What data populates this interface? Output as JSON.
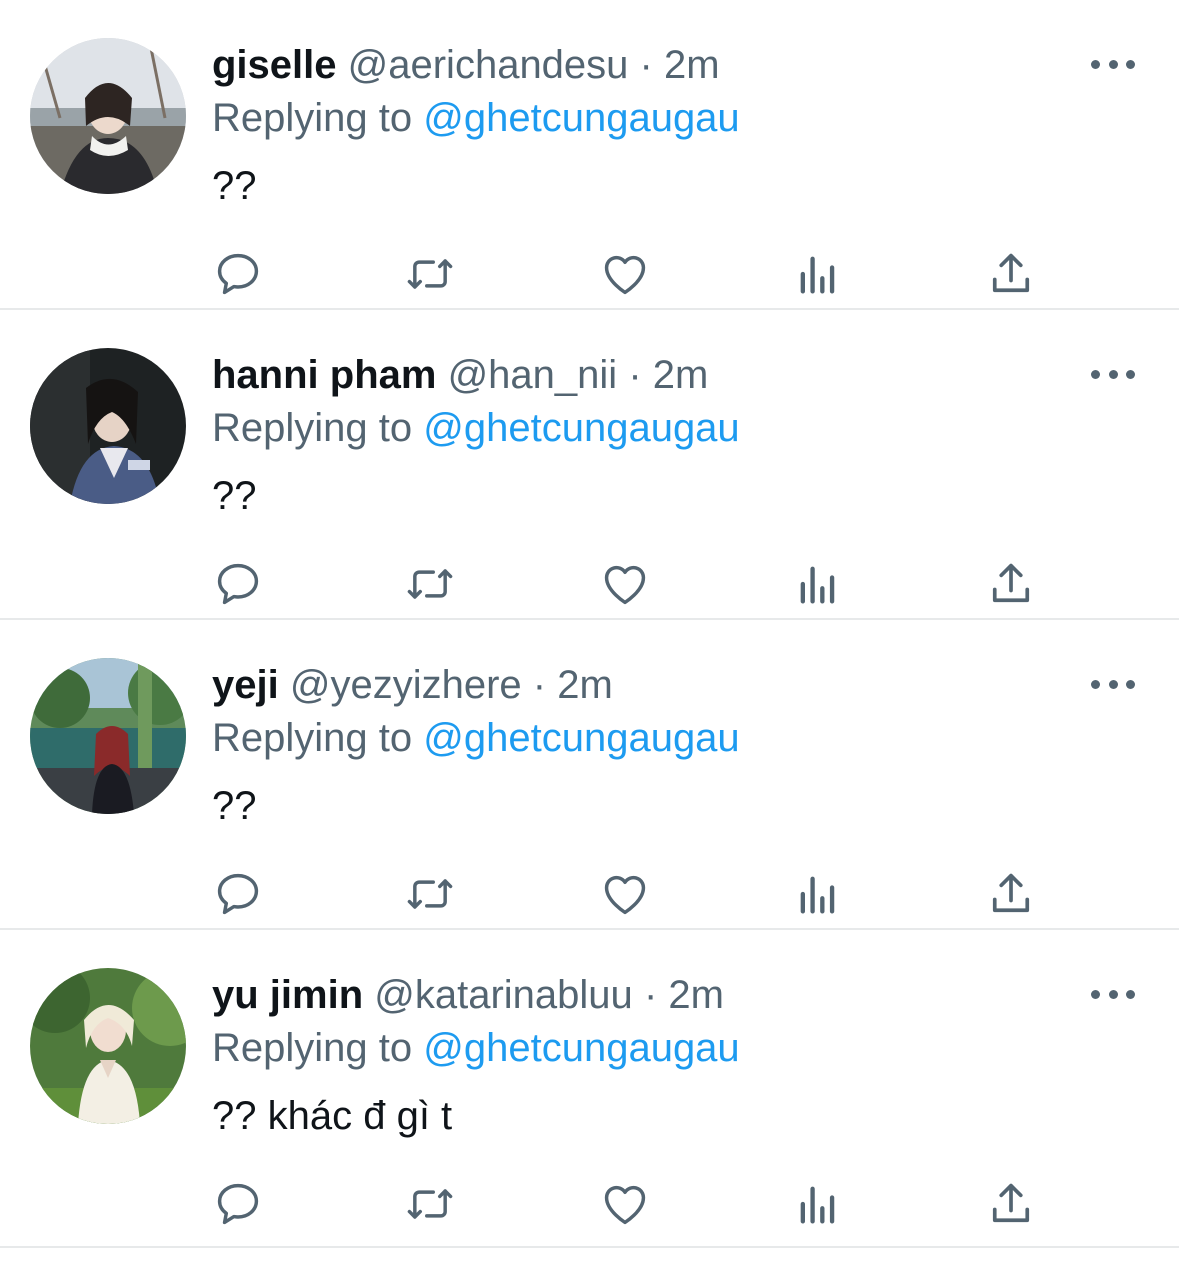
{
  "colors": {
    "text_primary": "#0f1419",
    "text_secondary": "#536471",
    "accent": "#1d9bf0",
    "divider": "#e7e9ea"
  },
  "tweets": [
    {
      "name": "giselle",
      "handle": "@aerichandesu",
      "dot": "·",
      "time": "2m",
      "replying_prefix": "Replying to",
      "replying_to": "@ghetcungaugau",
      "text": "??"
    },
    {
      "name": "hanni pham",
      "handle": "@han_nii",
      "dot": "·",
      "time": "2m",
      "replying_prefix": "Replying to",
      "replying_to": "@ghetcungaugau",
      "text": "??"
    },
    {
      "name": "yeji",
      "handle": "@yezyizhere",
      "dot": "·",
      "time": "2m",
      "replying_prefix": "Replying to",
      "replying_to": "@ghetcungaugau",
      "text": "??"
    },
    {
      "name": "yu jimin",
      "handle": "@katarinabluu",
      "dot": "·",
      "time": "2m",
      "replying_prefix": "Replying to",
      "replying_to": "@ghetcungaugau",
      "text": "?? khác đ gì t"
    }
  ],
  "icons": {
    "reply": "speech-bubble-icon",
    "retweet": "retweet-arrows-icon",
    "like": "heart-icon",
    "views": "bar-chart-icon",
    "share": "share-upload-icon",
    "more": "more-dots-icon"
  }
}
